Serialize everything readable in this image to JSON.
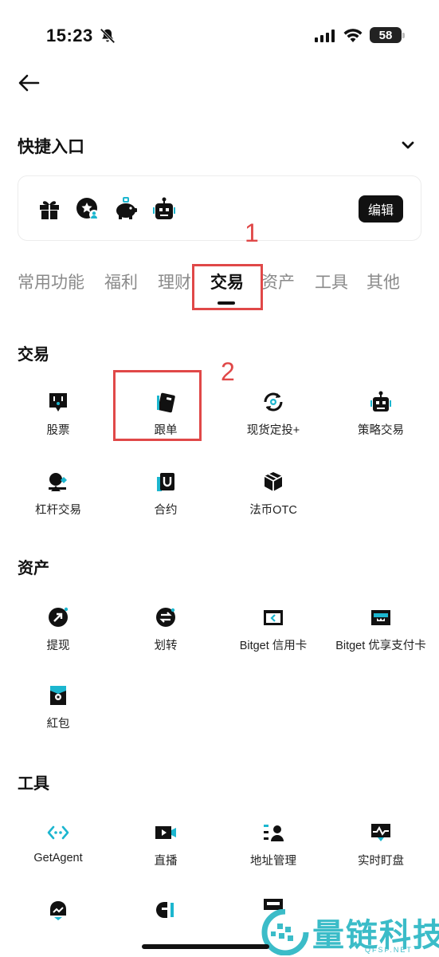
{
  "status_bar": {
    "time": "15:23",
    "battery": "58"
  },
  "quick_entry": {
    "title": "快捷入口",
    "edit_label": "编辑",
    "icons": [
      "gift-icon",
      "star-user-icon",
      "piggy-bank-icon",
      "robot-icon"
    ]
  },
  "annotations": {
    "one": "1",
    "two": "2"
  },
  "tabs": [
    {
      "label": "常用功能",
      "active": false
    },
    {
      "label": "福利",
      "active": false
    },
    {
      "label": "理财",
      "active": false
    },
    {
      "label": "交易",
      "active": true
    },
    {
      "label": "资产",
      "active": false
    },
    {
      "label": "工具",
      "active": false
    },
    {
      "label": "其他",
      "active": false
    }
  ],
  "sections": {
    "trade": {
      "title": "交易",
      "items": [
        {
          "label": "股票",
          "icon": "stock-icon"
        },
        {
          "label": "跟单",
          "icon": "copy-trade-icon"
        },
        {
          "label": "现货定投+",
          "icon": "spot-dca-icon"
        },
        {
          "label": "策略交易",
          "icon": "strategy-bot-icon"
        },
        {
          "label": "杠杆交易",
          "icon": "margin-icon"
        },
        {
          "label": "合约",
          "icon": "futures-icon"
        },
        {
          "label": "法币OTC",
          "icon": "otc-box-icon"
        }
      ]
    },
    "assets": {
      "title": "资产",
      "items": [
        {
          "label": "提现",
          "icon": "withdraw-icon"
        },
        {
          "label": "划转",
          "icon": "transfer-icon"
        },
        {
          "label": "Bitget 信用卡",
          "icon": "credit-card-icon"
        },
        {
          "label": "Bitget 优享支付卡",
          "icon": "pay-card-icon"
        },
        {
          "label": "紅包",
          "icon": "red-packet-icon"
        }
      ]
    },
    "tools": {
      "title": "工具",
      "items": [
        {
          "label": "GetAgent",
          "icon": "getagent-icon"
        },
        {
          "label": "直播",
          "icon": "live-icon"
        },
        {
          "label": "地址管理",
          "icon": "address-icon"
        },
        {
          "label": "实时盯盘",
          "icon": "monitor-icon"
        }
      ]
    }
  },
  "watermark": {
    "title": "量链科技",
    "sub": "QFSP.NET"
  },
  "colors": {
    "accent": "#1cb6cf",
    "annotation": "#e04848",
    "text": "#111111",
    "muted": "#8a8a8a"
  }
}
